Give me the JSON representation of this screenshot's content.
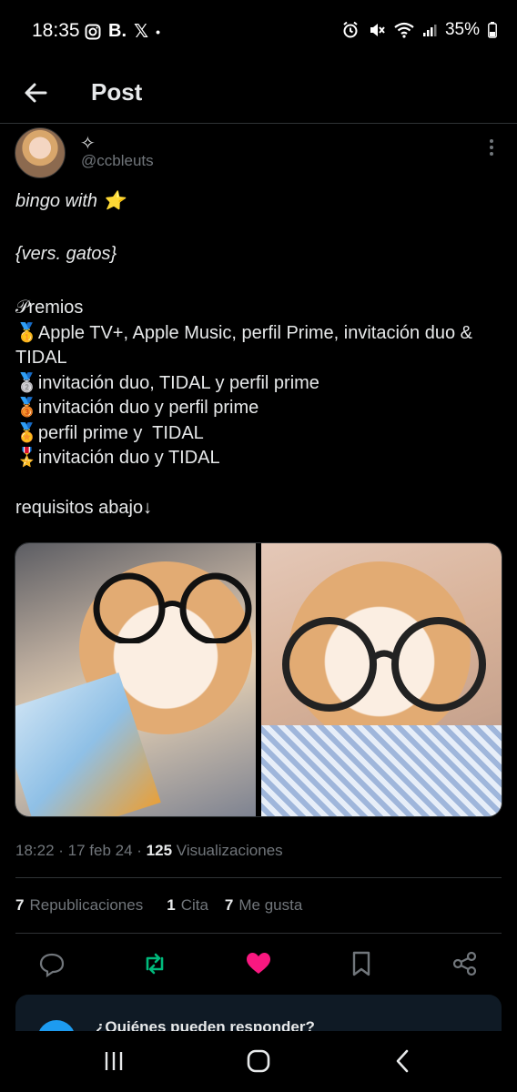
{
  "status_bar": {
    "time": "18:35",
    "left_icons": [
      "instagram-icon",
      "booking-icon",
      "x-icon",
      "dot-icon"
    ],
    "booking_glyph": "B.",
    "x_glyph": "𝕏",
    "dot_glyph": "•",
    "battery": "35%"
  },
  "header": {
    "title": "Post"
  },
  "author": {
    "display_name": "✧",
    "handle": "@ccbleuts"
  },
  "tweet": {
    "line1": "bingo with ⭐",
    "line2": "{vers. gatos}",
    "premios_title": "𝒫remios",
    "prize1": "🥇Apple TV+, Apple Music, perfil Prime, invitación duo & TIDAL",
    "prize2": "🥈invitación duo, TIDAL y perfil prime",
    "prize3": "🥉invitación duo y perfil prime",
    "prize4": "🏅perfil prime y  TIDAL",
    "prize5": "🎖️invitación duo y TIDAL",
    "footer": "requisitos abajo↓"
  },
  "meta": {
    "time": "18:22",
    "date": "17 feb 24",
    "views_count": "125",
    "views_label": "Visualizaciones"
  },
  "stats": {
    "reposts_count": "7",
    "reposts_label": "Republicaciones",
    "quotes_count": "1",
    "quotes_label": "Cita",
    "likes_count": "7",
    "likes_label": "Me gusta"
  },
  "reply_box": {
    "text": "¿Quiénes pueden responder?"
  },
  "colors": {
    "accent": "#1d9bf0",
    "like": "#f91880",
    "repost": "#00ba7c",
    "muted": "#71767b"
  }
}
